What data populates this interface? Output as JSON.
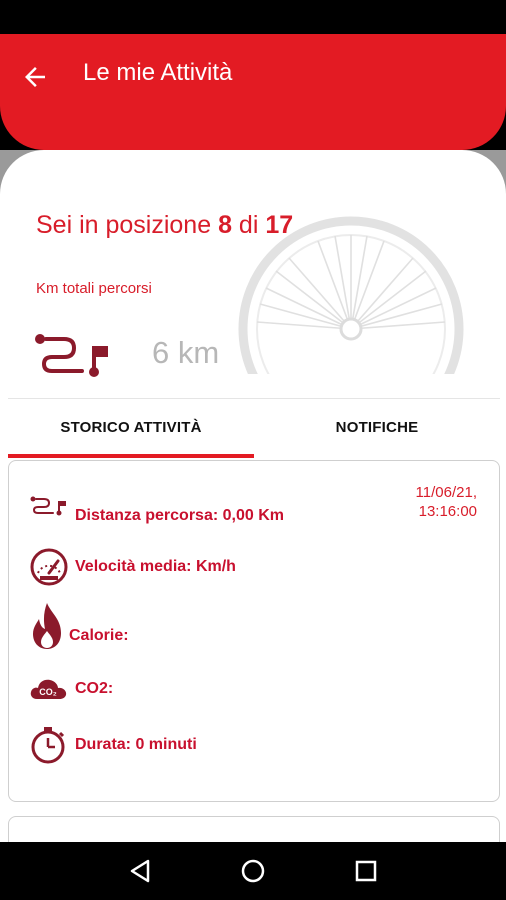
{
  "appbar": {
    "title": "Le mie Attività",
    "back_icon": "arrow-left-icon"
  },
  "ranking": {
    "prefix": "Sei in posizione ",
    "position": "8",
    "of_word": " di ",
    "total": "17"
  },
  "km": {
    "label": "Km totali percorsi",
    "value": "6 km"
  },
  "tabs": [
    {
      "label": "STORICO ATTIVITÀ",
      "selected": true
    },
    {
      "label": "NOTIFICHE",
      "selected": false
    }
  ],
  "activity": {
    "date_line1": "11/06/21,",
    "date_line2": "13:16:00",
    "distance": "Distanza percorsa: 0,00 Km",
    "speed": "Velocità media: Km/h",
    "calories": "Calorie:",
    "co2": "CO2:",
    "duration": "Durata: 0 minuti"
  },
  "colors": {
    "accent": "#e31b23",
    "text_accent": "#d81d2a",
    "icon": "#8b1a2b"
  }
}
